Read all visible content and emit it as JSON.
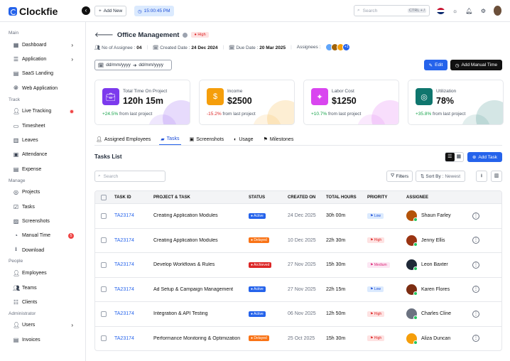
{
  "app": {
    "logo": "Clockfie"
  },
  "topbar": {
    "add_new": "Add New",
    "timer": "15:00:45 PM",
    "search_placeholder": "Search",
    "search_shortcut": "CTRL + /"
  },
  "sidebar": {
    "sections": {
      "main": "Main",
      "track": "Track",
      "manage": "Manage",
      "people": "People",
      "administrator": "Administrator"
    },
    "main_items": [
      {
        "label": "Dashboard",
        "icon": "dashboard-icon"
      },
      {
        "label": "Application",
        "icon": "application-icon"
      },
      {
        "label": "SaaS Landing",
        "icon": "saas-icon"
      },
      {
        "label": "Web Application",
        "icon": "globe-icon"
      }
    ],
    "track_items": [
      {
        "label": "Live Tracking",
        "icon": "live-tracking-icon"
      },
      {
        "label": "Timesheet",
        "icon": "timesheet-icon"
      },
      {
        "label": "Leaves",
        "icon": "leaves-icon"
      },
      {
        "label": "Attendance",
        "icon": "attendance-icon"
      },
      {
        "label": "Expense",
        "icon": "expense-icon"
      }
    ],
    "manage_items": [
      {
        "label": "Projects",
        "icon": "projects-icon"
      },
      {
        "label": "Tasks",
        "icon": "tasks-icon"
      },
      {
        "label": "Screenshots",
        "icon": "screenshots-icon"
      },
      {
        "label": "Manual Time",
        "icon": "manual-time-icon",
        "badge": "5"
      },
      {
        "label": "Download",
        "icon": "download-icon"
      }
    ],
    "people_items": [
      {
        "label": "Employees",
        "icon": "employees-icon"
      },
      {
        "label": "Teams",
        "icon": "teams-icon"
      },
      {
        "label": "Clients",
        "icon": "clients-icon"
      }
    ],
    "admin_items": [
      {
        "label": "Users",
        "icon": "users-icon"
      },
      {
        "label": "Invoices",
        "icon": "invoices-icon"
      }
    ]
  },
  "project": {
    "title": "Office Management",
    "priority": "High",
    "assignee_label": "No of Assignee :",
    "assignee_count": "04",
    "created_label": "Created Date :",
    "created_date": "24 Dec 2024",
    "due_label": "Due Date :",
    "due_date": "20 Mar 2025",
    "assignees_label": "Assignees :",
    "assignees_more": "+1"
  },
  "toolbar": {
    "date_from": "dd/mm/yyyy",
    "date_to": "dd/mm/yyyy",
    "edit": "Edit",
    "add_manual_time": "Add Manual Time"
  },
  "stats": [
    {
      "label": "Total Time On Project",
      "value": "120h 15m",
      "change": "+24.5%",
      "suffix": "from last project",
      "color": "#7c3aed",
      "change_color": "#16a34a",
      "icon": "briefcase-icon"
    },
    {
      "label": "Income",
      "value": "$2500",
      "change": "-15.2%",
      "suffix": "from last project",
      "color": "#f59e0b",
      "change_color": "#dc2626",
      "icon": "dollar-icon"
    },
    {
      "label": "Labor Cost",
      "value": "$1250",
      "change": "+10.7%",
      "suffix": "from last project",
      "color": "#d946ef",
      "change_color": "#16a34a",
      "icon": "labor-cost-icon"
    },
    {
      "label": "Utilization",
      "value": "78%",
      "change": "+35.8%",
      "suffix": "from last project",
      "color": "#0f766e",
      "change_color": "#16a34a",
      "icon": "utilization-icon"
    }
  ],
  "tabs": [
    {
      "label": "Assigned Employees",
      "icon": "assigned-employees-icon"
    },
    {
      "label": "Tasks",
      "icon": "tasks-tab-icon",
      "active": true
    },
    {
      "label": "Screenshots",
      "icon": "screenshots-tab-icon"
    },
    {
      "label": "Usage",
      "icon": "usage-icon"
    },
    {
      "label": "Milestones",
      "icon": "milestones-icon"
    }
  ],
  "tasks": {
    "title": "Tasks List",
    "add_task": "Add Task",
    "search_placeholder": "Search",
    "filters": "Filters",
    "sort_label": "Sort By :",
    "sort_value": "Newest",
    "columns": [
      "TASK ID",
      "PROJECT & TASK",
      "STATUS",
      "CREATED ON",
      "TOTAL HOURS",
      "PRIORITY",
      "ASSIGNEE"
    ],
    "rows": [
      {
        "id": "TA23174",
        "task": "Creating Application Modules",
        "status": "Active",
        "created": "24 Dec 2025",
        "hours": "30h 00m",
        "priority": "Low",
        "assignee": "Shaun Farley"
      },
      {
        "id": "TA23174",
        "task": "Creating Application Modules",
        "status": "Delayed",
        "created": "10 Dec 2025",
        "hours": "22h 30m",
        "priority": "High",
        "assignee": "Jenny Ellis"
      },
      {
        "id": "TA23174",
        "task": "Develop Workflows & Rules",
        "status": "Archieved",
        "created": "27 Nov 2025",
        "hours": "15h 30m",
        "priority": "Medium",
        "assignee": "Leon Baxter"
      },
      {
        "id": "TA23174",
        "task": "Ad Setup & Campaign Management",
        "status": "Active",
        "created": "27 Nov 2025",
        "hours": "22h 15m",
        "priority": "Low",
        "assignee": "Karen Flores"
      },
      {
        "id": "TA23174",
        "task": "Integration & API Testing",
        "status": "Active",
        "created": "06 Nov 2025",
        "hours": "12h 50m",
        "priority": "High",
        "assignee": "Charles Cline"
      },
      {
        "id": "TA23174",
        "task": "Performance Monitoring & Optimization",
        "status": "Delayed",
        "created": "25 Oct 2025",
        "hours": "15h 30m",
        "priority": "High",
        "assignee": "Aliza Duncan"
      }
    ]
  },
  "colors": {
    "accent": "#2563eb",
    "status": {
      "Active": "#2563eb",
      "Delayed": "#f97316",
      "Archieved": "#dc2626"
    },
    "priority_bg": {
      "Low": "#dbeafe",
      "High": "#fee2e2",
      "Medium": "#fce7f3"
    },
    "priority_fg": {
      "Low": "#1d4ed8",
      "High": "#dc2626",
      "Medium": "#db2777"
    }
  }
}
